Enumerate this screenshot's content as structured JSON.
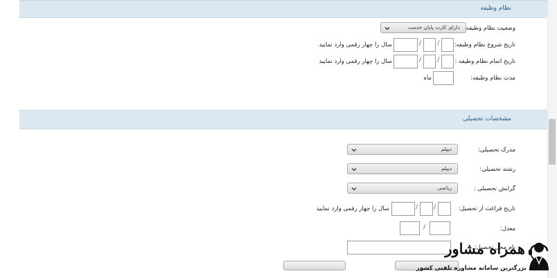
{
  "military_section": {
    "title": "نظام وظیفه",
    "status_label": "وضعیت نظام وظیفه:",
    "status_value": "دارای کارت پایان خدمت",
    "start_date_label": "تاریخ شروع نظام وظیفه:",
    "end_date_label": "تاریخ اتمام نظام وظیفه :",
    "year_hint": "سال را چهار رقمی وارد نمایید",
    "date_separator": "/",
    "duration_label": "مدت نظام وظیفه:",
    "duration_unit": "ماه"
  },
  "education_section": {
    "title": "مشخصات تحصیلی",
    "degree_label": "مدرک تحصیلی:",
    "degree_value": "دیپلم",
    "field_label": "رشته تحصیلی:",
    "field_value": "دیپلم",
    "orientation_label": "گرایش تحصیلی :",
    "orientation_value": "ریاضی",
    "graduation_date_label": "تاریخ فراغت از تحصیل:",
    "year_hint": "سال را چهار رقمی وارد نمایید",
    "date_separator": "/",
    "gpa_label": "معدل:",
    "gpa_separator": "/",
    "institution_label": "نام محل تحصیل:"
  },
  "watermark": {
    "brand": "همراه مشاور",
    "tagline": "بزرگترین سامانه مشاوره تلفنی کشور"
  },
  "icons": {
    "select_arrow": "chevron-down-icon",
    "logo": "headset-person-icon"
  },
  "colors": {
    "section_bar": "#dbe8f1",
    "section_title": "#2a5d8a"
  }
}
